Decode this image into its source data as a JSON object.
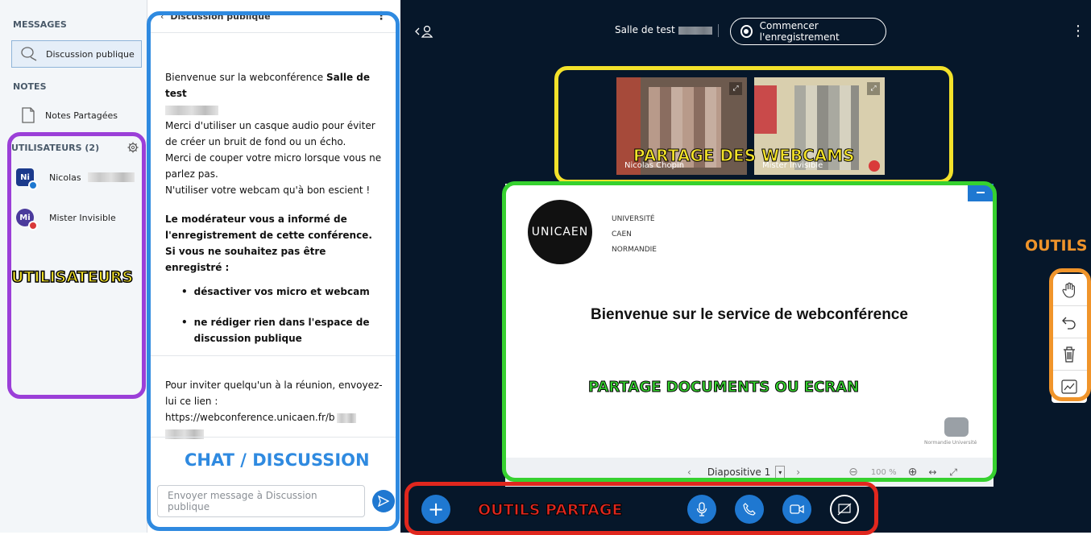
{
  "sidebar": {
    "messages_title": "MESSAGES",
    "public_chat": "Discussion publique",
    "notes_title": "NOTES",
    "shared_notes": "Notes Partagées",
    "users_title": "UTILISATEURS (2)",
    "users": [
      {
        "initials": "Ni",
        "name": "Nicolas",
        "color": "#1b3a8c",
        "badge": "#1f78d1"
      },
      {
        "initials": "Mi",
        "name": "Mister Invisible",
        "color": "#4a3a9c",
        "badge": "#d93a3a"
      }
    ]
  },
  "chat": {
    "header": "Discussion publique",
    "welcome_prefix": "Bienvenue sur la webconférence ",
    "welcome_room": "Salle de test",
    "rules": [
      "Merci d'utiliser un casque audio pour éviter de créer un bruit de fond ou un écho.",
      "Merci de couper votre micro lorsque vous ne parlez pas.",
      "N'utiliser votre webcam qu'à bon escient !"
    ],
    "recording_notice": "Le modérateur vous a informé de l'enregistrement de cette conférence.",
    "if_no_record": "Si vous ne souhaitez pas être enregistré :",
    "bullets": [
      "désactiver vos micro et webcam",
      "ne rédiger rien dans l'espace de discussion publique"
    ],
    "invite": "Pour inviter quelqu'un à la réunion, envoyez-lui ce lien : https://webconference.unicaen.fr/b",
    "input_placeholder": "Envoyer message à Discussion publique"
  },
  "topbar": {
    "room": "Salle de test",
    "record_button": "Commencer l'enregistrement"
  },
  "webcams": [
    {
      "name": "Nicolas Chopin"
    },
    {
      "name": "Mister Invisible"
    }
  ],
  "slide": {
    "university": [
      "UNIVERSITÉ",
      "CAEN",
      "NORMANDIE"
    ],
    "logo_text": "UNICAEN",
    "title": "Bienvenue sur le service de webconférence",
    "footer_logo_text": "Normandie Université",
    "slide_label": "Diapositive 1",
    "zoom": "100 %"
  },
  "annotations": {
    "users": "UTILISATEURS",
    "chat": "CHAT / DISCUSSION",
    "webcams": "PARTAGE DES WEBCAMS",
    "documents": "PARTAGE DOCUMENTS OU ECRAN",
    "tools": "OUTILS",
    "share_tools": "OUTILS PARTAGE"
  },
  "colors": {
    "users": "#9b3fd8",
    "chat": "#2f8ae0",
    "webcams": "#f3e22a",
    "documents": "#36d12f",
    "tools": "#f0942a",
    "share_tools": "#e0271e",
    "accent": "#1f78d1"
  }
}
